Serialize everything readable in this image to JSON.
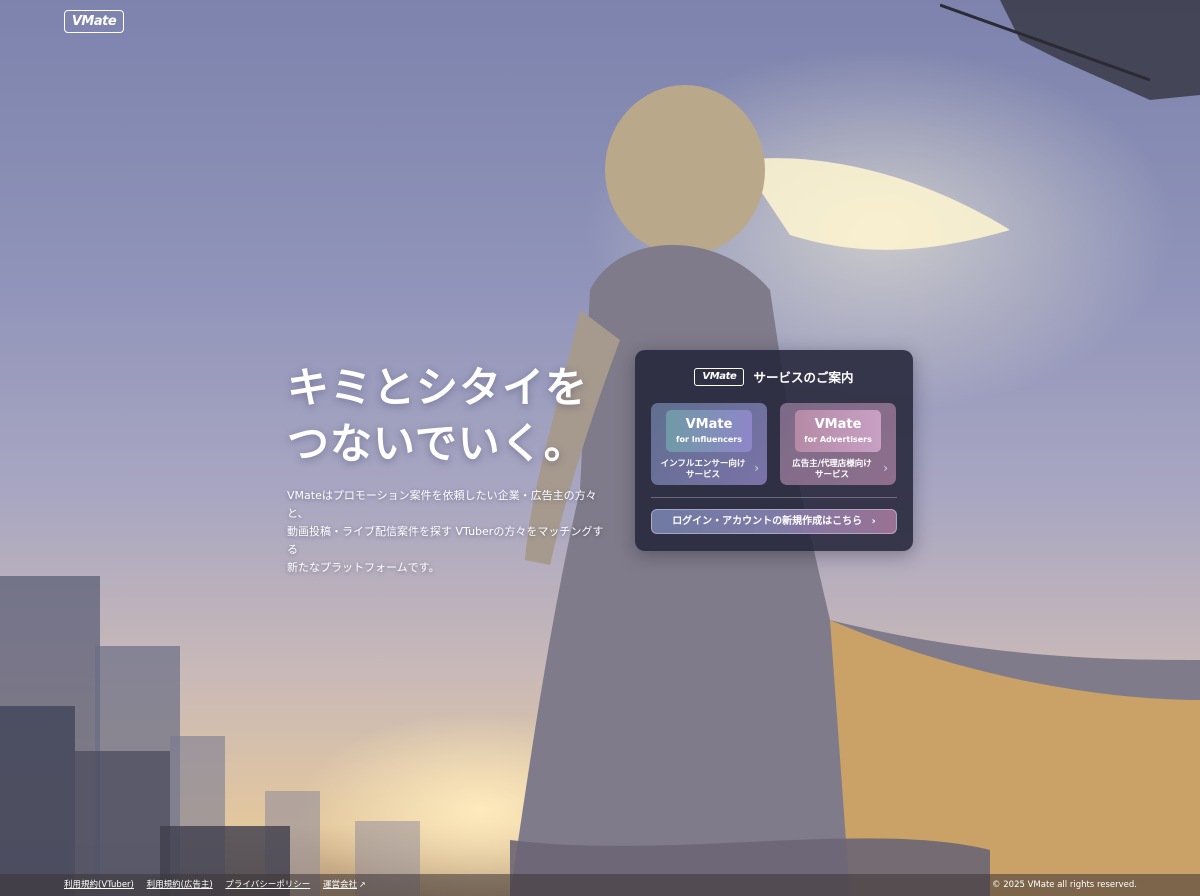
{
  "header": {
    "logo_text": "VMate"
  },
  "hero": {
    "title_line1": "キミとシタイを",
    "title_line2": "つないでいく。",
    "description_line1": "VMateはプロモーション案件を依頼したい企業・広告主の方々と、",
    "description_line2": "動画投稿・ライブ配信案件を探す VTuberの方々をマッチングする",
    "description_line3": "新たなプラットフォームです。"
  },
  "panel": {
    "logo_text": "VMate",
    "title": "サービスのご案内",
    "cards": [
      {
        "name": "VMate",
        "sub": "for Influencers",
        "label_line1": "インフルエンサー向け",
        "label_line2": "サービス"
      },
      {
        "name": "VMate",
        "sub": "for Advertisers",
        "label_line1": "広告主/代理店様向け",
        "label_line2": "サービス"
      }
    ],
    "login_label": "ログイン・アカウントの新規作成はこちら"
  },
  "footer": {
    "links": [
      "利用規約(VTuber)",
      "利用規約(広告主)",
      "プライバシーポリシー",
      "運営会社"
    ],
    "copyright": "© 2025 VMate all rights reserved."
  },
  "icons": {
    "chevron": "chevron-right-icon",
    "external": "external-link-icon"
  }
}
